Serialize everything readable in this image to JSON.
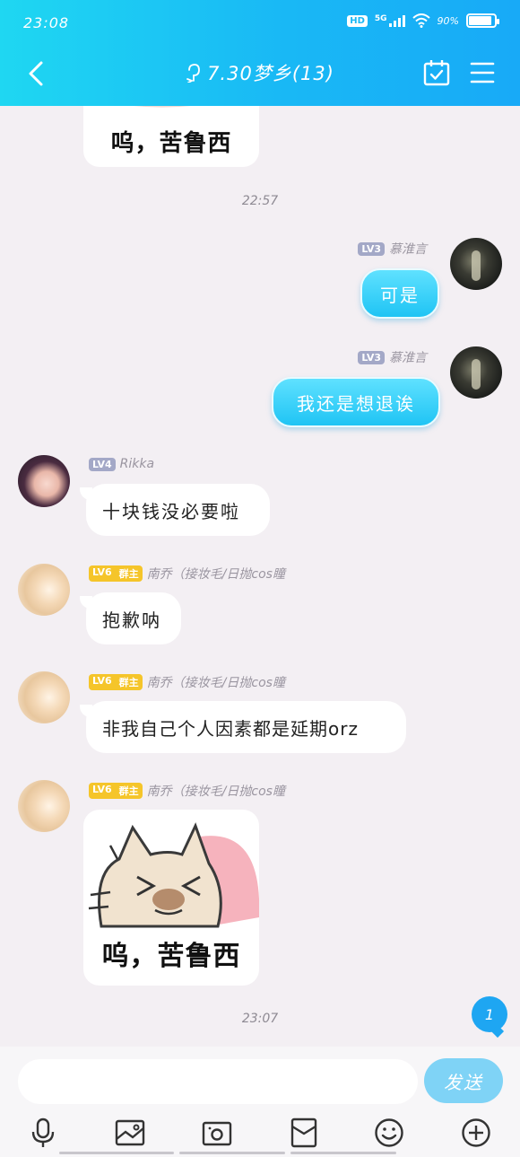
{
  "status_bar": {
    "time": "23:08",
    "hd": "HD",
    "network": "5G",
    "battery": "90%"
  },
  "header": {
    "title": "7.30梦乡(13)"
  },
  "messages": {
    "sticker_caption_1": "呜，苦鲁西",
    "time_1": "22:57",
    "self_name": "慕淮言",
    "self_level": "LV3",
    "self_msg_1": "可是",
    "self_msg_2": "我还是想退诶",
    "rikka_name": "Rikka",
    "rikka_level": "LV4",
    "rikka_msg": "十块钱没必要啦",
    "nq_name": "南乔（接妆毛/日抛cos瞳",
    "nq_level": "LV6",
    "nq_role": "群主",
    "nq_msg_1": "抱歉呐",
    "nq_msg_2": "非我自己个人因素都是延期orz",
    "sticker_caption_2": "呜，苦鲁西",
    "time_2": "23:07"
  },
  "unread_count": "1",
  "input": {
    "placeholder": "",
    "send_label": "发送"
  },
  "icons": [
    "microphone-icon",
    "image-icon",
    "camera-icon",
    "red-packet-icon",
    "emoji-icon",
    "plus-icon"
  ],
  "colors": {
    "header_start": "#1fd7f2",
    "header_end": "#18aaf7",
    "self_bubble": "#1fc4f4",
    "send_button": "#7fd3f6"
  }
}
